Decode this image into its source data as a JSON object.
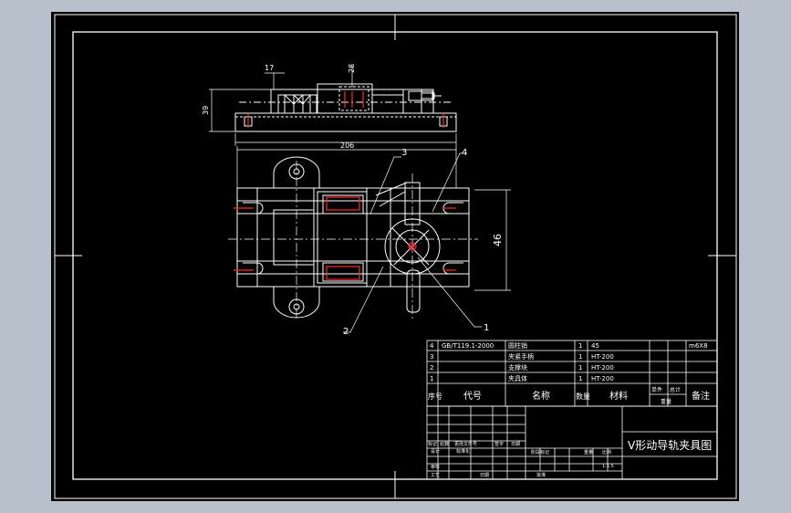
{
  "colors": {
    "outer_background": "#b8c0cc",
    "canvas": "#000000",
    "lines": "#ffffff",
    "highlight": "#ff2a2a"
  },
  "drawing": {
    "title": "V形动导轨夹具图",
    "scale": "1:1.5"
  },
  "dimensions": {
    "top_width_a": "17",
    "top_width_b": "28",
    "top_height": "39",
    "overall_length": "206",
    "right_height": "46"
  },
  "balloons": [
    "1",
    "2",
    "3",
    "4"
  ],
  "parts": {
    "rows": [
      {
        "no": "4",
        "code": "GB/T119.1-2000",
        "name": "圆柱销",
        "qty": "1",
        "material": "45",
        "remark": "m6X8"
      },
      {
        "no": "3",
        "code": "",
        "name": "夹紧手柄",
        "qty": "1",
        "material": "HT-200",
        "remark": ""
      },
      {
        "no": "2",
        "code": "",
        "name": "支撑块",
        "qty": "1",
        "material": "HT-200",
        "remark": ""
      },
      {
        "no": "1",
        "code": "",
        "name": "夹具体",
        "qty": "1",
        "material": "HT-200",
        "remark": ""
      }
    ],
    "header": {
      "no": "序号",
      "code": "代号",
      "name": "名称",
      "qty": "数量",
      "material": "材料",
      "unit": "单件",
      "total": "总计",
      "weight": "重量",
      "remark": "备注"
    }
  },
  "title_block": {
    "mark": "标记",
    "count": "处数",
    "file": "更改文件号",
    "sign": "签字",
    "date": "日期",
    "design": "设计",
    "standard": "标准化",
    "stage": "阶段标记",
    "weight": "重量",
    "ratio": "比例",
    "review": "审核",
    "process": "工艺",
    "approve": "批准",
    "day": "日期"
  }
}
